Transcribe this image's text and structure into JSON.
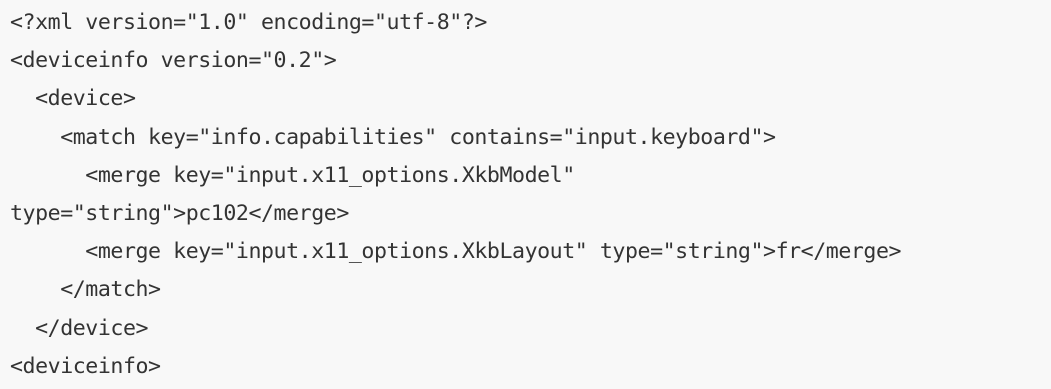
{
  "code": {
    "lines": [
      "<?xml version=\"1.0\" encoding=\"utf-8\"?>",
      "<deviceinfo version=\"0.2\">",
      "  <device>",
      "    <match key=\"info.capabilities\" contains=\"input.keyboard\">",
      "      <merge key=\"input.x11_options.XkbModel\"",
      "type=\"string\">pc102</merge>",
      "      <merge key=\"input.x11_options.XkbLayout\" type=\"string\">fr</merge>",
      "    </match>",
      "  </device>",
      "<deviceinfo>"
    ]
  }
}
